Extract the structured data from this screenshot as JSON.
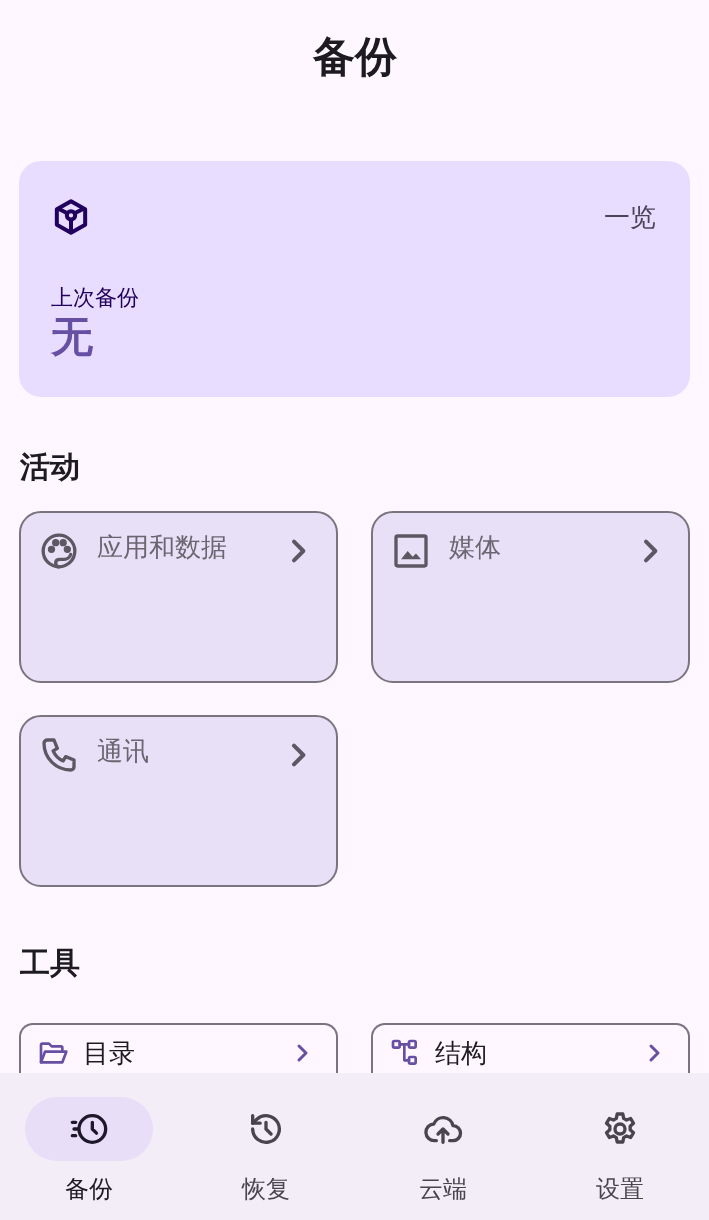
{
  "title": "备份",
  "summary": {
    "action": "一览",
    "label": "上次备份",
    "value": "无"
  },
  "sections": [
    {
      "heading": "活动",
      "kind": "large",
      "items": [
        {
          "label": "应用和数据",
          "disabled": true
        },
        {
          "label": "媒体",
          "disabled": true
        },
        {
          "label": "通讯",
          "disabled": true
        }
      ]
    },
    {
      "heading": "工具",
      "kind": "small",
      "items": [
        {
          "label": "目录",
          "disabled": false
        },
        {
          "label": "结构",
          "disabled": false
        }
      ]
    }
  ],
  "nav": [
    {
      "label": "备份",
      "selected": true
    },
    {
      "label": "恢复",
      "selected": false
    },
    {
      "label": "云端",
      "selected": false
    },
    {
      "label": "设置",
      "selected": false
    }
  ]
}
